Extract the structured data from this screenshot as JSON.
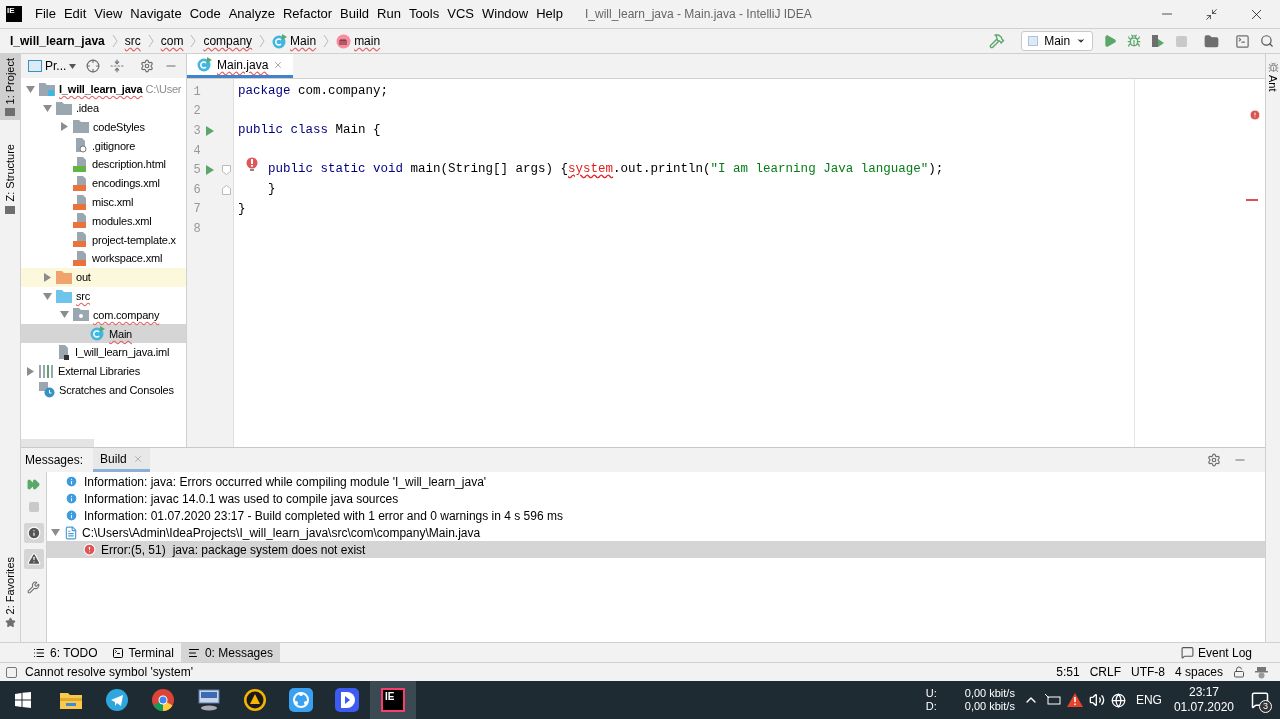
{
  "app_icon": "IE",
  "menu": [
    "File",
    "Edit",
    "View",
    "Navigate",
    "Code",
    "Analyze",
    "Refactor",
    "Build",
    "Run",
    "Tools",
    "VCS",
    "Window",
    "Help"
  ],
  "window_title": "I_will_learn_java - Main.java - IntelliJ IDEA",
  "breadcrumbs": [
    {
      "label": "I_will_learn_java",
      "kind": "project",
      "typo": false
    },
    {
      "label": "src",
      "kind": "folder",
      "typo": true
    },
    {
      "label": "com",
      "kind": "folder",
      "typo": true
    },
    {
      "label": "company",
      "kind": "folder",
      "typo": true
    },
    {
      "label": "Main",
      "kind": "class",
      "typo": true
    },
    {
      "label": "main",
      "kind": "method",
      "typo": true
    }
  ],
  "run_config": "Main",
  "left_strip": [
    {
      "label": "1: Project",
      "selected": true
    },
    {
      "label": "Z: Structure",
      "selected": false
    }
  ],
  "favorites": "2: Favorites",
  "project_panel": {
    "title": "Pr...",
    "tree": [
      {
        "label": "I_will_learn_java",
        "kind": "module",
        "hint": "C:\\User",
        "expanded": true,
        "selected": false,
        "typo": true,
        "children": [
          {
            "label": ".idea",
            "kind": "folder",
            "expanded": true,
            "selected": false,
            "typo": false,
            "children": [
              {
                "label": "codeStyles",
                "kind": "folder",
                "expanded": false,
                "selected": false,
                "typo": false
              },
              {
                "label": ".gitignore",
                "kind": "ignore",
                "selected": false,
                "typo": false
              },
              {
                "label": "description.html",
                "kind": "html",
                "selected": false,
                "typo": false
              },
              {
                "label": "encodings.xml",
                "kind": "xml",
                "selected": false,
                "typo": false
              },
              {
                "label": "misc.xml",
                "kind": "xml",
                "selected": false,
                "typo": false
              },
              {
                "label": "modules.xml",
                "kind": "xml",
                "selected": false,
                "typo": false
              },
              {
                "label": "project-template.x",
                "kind": "xml",
                "selected": false,
                "typo": false
              },
              {
                "label": "workspace.xml",
                "kind": "xml",
                "selected": false,
                "typo": false
              }
            ]
          },
          {
            "label": "out",
            "kind": "excluded",
            "expanded": false,
            "selected": false,
            "typo": false
          },
          {
            "label": "src",
            "kind": "source",
            "expanded": true,
            "selected": false,
            "typo": true,
            "children": [
              {
                "label": "com.company",
                "kind": "package",
                "expanded": true,
                "selected": false,
                "typo": true,
                "children": [
                  {
                    "label": "Main",
                    "kind": "class",
                    "selected": true,
                    "typo": true
                  }
                ]
              }
            ]
          },
          {
            "label": "I_will_learn_java.iml",
            "kind": "iml",
            "selected": false,
            "typo": false
          }
        ]
      },
      {
        "label": "External Libraries",
        "kind": "libraries",
        "expanded": false,
        "selected": false,
        "typo": false
      },
      {
        "label": "Scratches and Consoles",
        "kind": "scratches",
        "selected": false,
        "typo": false
      }
    ]
  },
  "editor_tab": {
    "label": "Main.java",
    "selected": true,
    "typo": true
  },
  "code_lines": [
    {
      "number": "1",
      "run": false,
      "fold": false,
      "error": false,
      "tokens": [
        {
          "text": "package",
          "kind": "keyword"
        },
        {
          "text": " com.company;",
          "kind": "plain"
        }
      ]
    },
    {
      "number": "2",
      "run": false,
      "fold": false,
      "error": false
    },
    {
      "number": "3",
      "run": true,
      "fold": false,
      "error": false,
      "tokens": [
        {
          "text": "public class",
          "kind": "keyword"
        },
        {
          "text": " Main {",
          "kind": "plain"
        }
      ]
    },
    {
      "number": "4",
      "run": false,
      "fold": false,
      "error": false
    },
    {
      "number": "5",
      "run": true,
      "fold": true,
      "error": true,
      "indented": true,
      "tokens": [
        {
          "text": "public static void",
          "kind": "keyword"
        },
        {
          "text": " main(String[] args) {",
          "kind": "plain"
        },
        {
          "text": "system",
          "kind": "error"
        },
        {
          "text": ".out.println(",
          "kind": "plain"
        },
        {
          "text": "\"I am learning Java language\"",
          "kind": "string"
        },
        {
          "text": ");",
          "kind": "plain"
        }
      ]
    },
    {
      "number": "6",
      "run": false,
      "fold": true,
      "error": false,
      "indented": true,
      "tokens": [
        {
          "text": "}",
          "kind": "plain"
        }
      ]
    },
    {
      "number": "7",
      "run": false,
      "fold": false,
      "error": false,
      "tokens": [
        {
          "text": "}",
          "kind": "plain"
        }
      ]
    },
    {
      "number": "8",
      "run": false,
      "fold": false,
      "error": false
    }
  ],
  "right_strip": "Ant",
  "bottom_panel": {
    "label": "Messages:",
    "tabs": [
      {
        "label": "Build",
        "selected": true
      }
    ],
    "messages": [
      {
        "kind": "info",
        "text": "Information: java: Errors occurred while compiling module 'I_will_learn_java'"
      },
      {
        "kind": "info",
        "text": "Information: javac 14.0.1 was used to compile java sources"
      },
      {
        "kind": "info",
        "text": "Information: 01.07.2020 23:17 - Build completed with 1 error and 0 warnings in 4 s 596 ms"
      },
      {
        "kind": "file",
        "text": "C:\\Users\\Admin\\IdeaProjects\\I_will_learn_java\\src\\com\\company\\Main.java",
        "expanded": true,
        "children": [
          {
            "kind": "error",
            "location": "Error:(5, 51)",
            "text": "java: package system does not exist",
            "selected": true
          }
        ]
      }
    ]
  },
  "bottom_tabs": [
    {
      "label": "6: TODO",
      "kind": "todo",
      "selected": false
    },
    {
      "label": "Terminal",
      "kind": "terminal",
      "selected": false
    },
    {
      "label": "0: Messages",
      "kind": "messages",
      "selected": true
    }
  ],
  "event_log": "Event Log",
  "status": {
    "message": "Cannot resolve symbol 'system'",
    "position": "5:51",
    "line_separator": "CRLF",
    "encoding": "UTF-8",
    "indent": "4 spaces"
  },
  "taskbar": {
    "apps": [
      {
        "kind": "explorer",
        "active": false
      },
      {
        "kind": "telegram",
        "active": false
      },
      {
        "kind": "chrome",
        "active": false
      },
      {
        "kind": "computer",
        "active": false
      },
      {
        "kind": "triangle",
        "active": false
      },
      {
        "kind": "share",
        "active": false
      },
      {
        "kind": "player",
        "active": false
      },
      {
        "kind": "idea",
        "label": "IE",
        "active": true
      }
    ],
    "net": {
      "up_label": "U:",
      "down_label": "D:",
      "up": "0,00 kbit/s",
      "down": "0,00 kbit/s"
    },
    "language": "ENG",
    "time": "23:17",
    "date": "01.07.2020",
    "notifications": "3"
  }
}
